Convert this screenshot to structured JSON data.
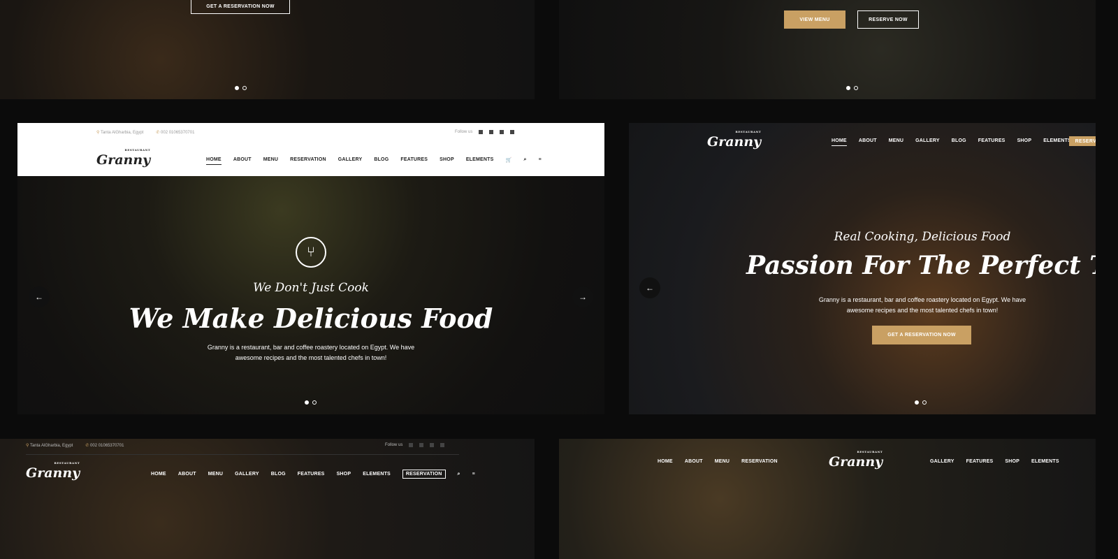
{
  "brand": {
    "name": "Granny",
    "tag": "RESTAURANT"
  },
  "colors": {
    "accent": "#c9a063",
    "background": "#0b0b0b"
  },
  "top_left": {
    "button": "GET A RESERVATION NOW"
  },
  "top_right": {
    "view_menu": "VIEW MENU",
    "reserve": "RESERVE NOW"
  },
  "mid_left": {
    "address": "Tanta AlGharbia, Egypt",
    "phone": "002 01065370701",
    "follow": "Follow us",
    "nav": [
      "HOME",
      "ABOUT",
      "MENU",
      "RESERVATION",
      "GALLERY",
      "BLOG",
      "FEATURES",
      "SHOP",
      "ELEMENTS"
    ],
    "subtitle": "We Don't Just Cook",
    "title": "We Make Delicious Food",
    "text1": "Granny is a restaurant, bar and coffee roastery located on Egypt. We have",
    "text2": "awesome recipes and the most talented chefs in town!"
  },
  "mid_right": {
    "nav": [
      "HOME",
      "ABOUT",
      "MENU",
      "GALLERY",
      "BLOG",
      "FEATURES",
      "SHOP",
      "ELEMENTS"
    ],
    "reserve": "RESERVATION",
    "subtitle": "Real Cooking, Delicious Food",
    "title": "Passion For The Perfect Taste",
    "text1": "Granny is a restaurant, bar and coffee roastery located on Egypt. We have",
    "text2": "awesome recipes and the most talented chefs in town!",
    "button": "GET A RESERVATION NOW"
  },
  "bottom_left": {
    "address": "Tanta AlGharbia, Egypt",
    "phone": "002 01065370701",
    "follow": "Follow us",
    "nav": [
      "HOME",
      "ABOUT",
      "MENU",
      "GALLERY",
      "BLOG",
      "FEATURES",
      "SHOP",
      "ELEMENTS"
    ],
    "reserve": "RESERVATION"
  },
  "bottom_right": {
    "nav_left": [
      "HOME",
      "ABOUT",
      "MENU",
      "RESERVATION"
    ],
    "nav_right": [
      "GALLERY",
      "FEATURES",
      "SHOP",
      "ELEMENTS"
    ]
  }
}
